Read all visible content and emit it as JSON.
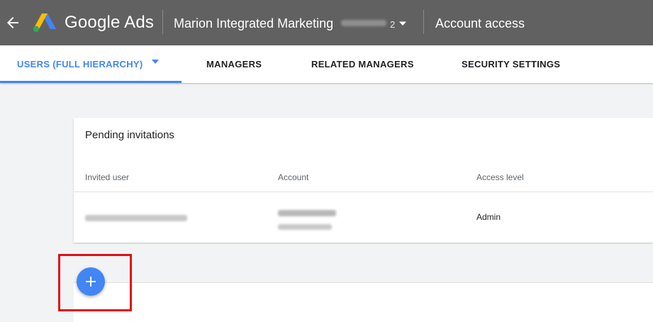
{
  "header": {
    "brand": "Google Ads",
    "account_name": "Marion Integrated Marketing",
    "account_id_suffix": "2",
    "page_title": "Account access",
    "icons": [
      "back-arrow-icon",
      "google-ads-logo",
      "chevron-down-icon"
    ]
  },
  "tabs": [
    {
      "label": "USERS (FULL HIERARCHY)",
      "active": true
    },
    {
      "label": "MANAGERS",
      "active": false
    },
    {
      "label": "RELATED MANAGERS",
      "active": false
    },
    {
      "label": "SECURITY SETTINGS",
      "active": false
    }
  ],
  "pending": {
    "title": "Pending invitations",
    "columns": [
      "Invited user",
      "Account",
      "Access level"
    ],
    "rows": [
      {
        "access_level": "Admin"
      }
    ]
  },
  "fab": {
    "icon": "plus-icon"
  },
  "colors": {
    "accent": "#4285f4",
    "header": "#616161",
    "highlight": "#e0101a"
  }
}
